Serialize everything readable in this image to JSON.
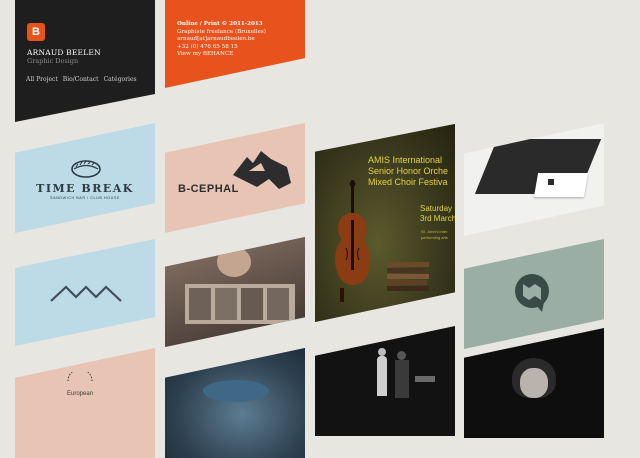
{
  "header": {
    "logo_text": "B",
    "name": "ARNAUD BEELEN",
    "subtitle": "Graphic Design",
    "nav": [
      {
        "label": "All Project"
      },
      {
        "label": "Bio/Contact"
      },
      {
        "label": "Catégories"
      }
    ]
  },
  "info": {
    "line1": "Online / Print © 2011-2013",
    "line2": "Graphiste freelance (Bruxelles)",
    "line3": "arnaud[at]arnaudbeelen.be",
    "line4": "+32 (0) 476 65 58 15",
    "line5": "View my BEHANCE"
  },
  "tiles": {
    "timebreak": {
      "title": "TIME BREAK",
      "sub": "SANDWICH BAR / CLUB HOUSE"
    },
    "bcephal": {
      "title": "B-CEPHAL"
    },
    "amis": {
      "l1": "AMIS International",
      "l2": "Senior Honor Orche",
      "l3": "Mixed Choir Festiva",
      "d1": "Saturday",
      "d2": "3rd March",
      "s1": "St. John's inter",
      "s2": "performing arts"
    },
    "european": {
      "text": "European"
    }
  },
  "colors": {
    "dark": "#1e1e1e",
    "orange": "#e8521c",
    "blue": "#bcdbe6",
    "peach": "#e7c4b3",
    "sage": "#9aaea6"
  }
}
